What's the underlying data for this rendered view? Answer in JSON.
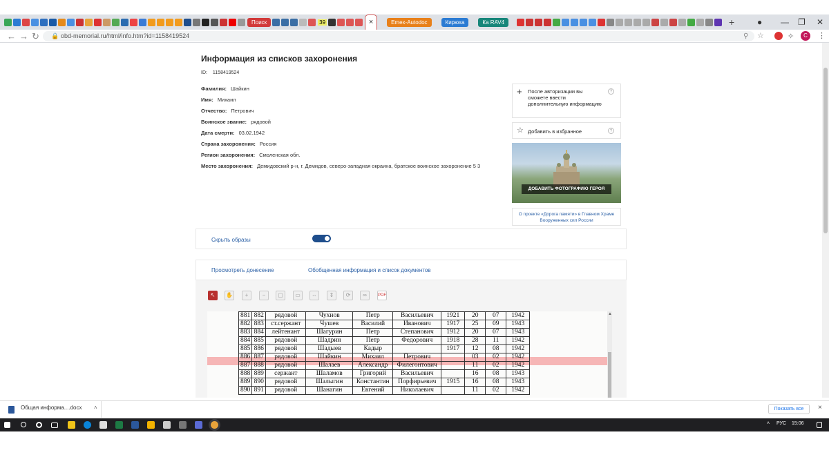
{
  "browser": {
    "tabs": {
      "search_pill": "Поиск",
      "num_badge": "39",
      "active_close": "×",
      "pill_orange": "Emex-Autodoc",
      "pill_blue": "Кирюха",
      "pill_teal": "Ка RAV4",
      "new_tab": "+"
    },
    "url": "obd-memorial.ru/html/info.htm?id=1158419524",
    "profile_initial": "C"
  },
  "page": {
    "title": "Информация из списков захоронения",
    "id_label": "ID:",
    "id_value": "1158419524",
    "fields": [
      {
        "label": "Фамилия:",
        "value": "Шайкин"
      },
      {
        "label": "Имя:",
        "value": "Михаил"
      },
      {
        "label": "Отчество:",
        "value": "Петрович"
      },
      {
        "label": "Воинское звание:",
        "value": "рядовой"
      },
      {
        "label": "Дата смерти:",
        "value": "03.02.1942"
      },
      {
        "label": "Страна захоронения:",
        "value": "Россия"
      },
      {
        "label": "Регион захоронения:",
        "value": "Смоленская обл."
      },
      {
        "label": "Место захоронения:",
        "value": "Демидовский р-н, г. Демидов, северо-западная окраина, братское воинское захоронение 5 3"
      }
    ],
    "sidebar": {
      "auth_text": "После авторизации вы сможете ввести дополнительную информацию",
      "favorite_text": "Добавить в избранное",
      "photo_button": "ДОБАВИТЬ ФОТОГРАФИЮ ГЕРОЯ",
      "about_link": "О проекте «Дорога памяти» в Главном Храме Вооруженных сил России"
    },
    "hide_images_label": "Скрыть образы",
    "hide_images_on": true,
    "tabs": {
      "report": "Просмотреть донесение",
      "summary": "Обобщенная информация и список документов"
    },
    "viewer_tools": [
      "select-icon",
      "hand-icon",
      "zoom-in-icon",
      "zoom-out-icon",
      "frame-icon",
      "fit-icon",
      "fit-width-icon",
      "fit-height-icon",
      "rotate-icon",
      "link-icon",
      "pdf-icon"
    ],
    "scan_rows": [
      {
        "n1": "881",
        "n2": "882",
        "rank": "рядовой",
        "surname": "Чухнов",
        "name": "Петр",
        "patronymic": "Васильевич",
        "year": "1921",
        "day": "20",
        "month": "07",
        "death_year": "1942"
      },
      {
        "n1": "882",
        "n2": "883",
        "rank": "ст.сержант",
        "surname": "Чушев",
        "name": "Василий",
        "patronymic": "Иванович",
        "year": "1917",
        "day": "25",
        "month": "09",
        "death_year": "1943"
      },
      {
        "n1": "883",
        "n2": "884",
        "rank": "лейтенант",
        "surname": "Шагурин",
        "name": "Петр",
        "patronymic": "Степанович",
        "year": "1912",
        "day": "20",
        "month": "07",
        "death_year": "1943"
      },
      {
        "n1": "884",
        "n2": "885",
        "rank": "рядовой",
        "surname": "Шадрин",
        "name": "Петр",
        "patronymic": "Федорович",
        "year": "1918",
        "day": "28",
        "month": "11",
        "death_year": "1942"
      },
      {
        "n1": "885",
        "n2": "886",
        "rank": "рядовой",
        "surname": "Шадыев",
        "name": "Кадыр",
        "patronymic": "",
        "year": "1917",
        "day": "12",
        "month": "08",
        "death_year": "1942"
      },
      {
        "n1": "886",
        "n2": "887",
        "rank": "рядовой",
        "surname": "Шайкин",
        "name": "Михаил",
        "patronymic": "Петрович",
        "year": "",
        "day": "03",
        "month": "02",
        "death_year": "1942"
      },
      {
        "n1": "887",
        "n2": "888",
        "rank": "рядовой",
        "surname": "Шалаев",
        "name": "Александр",
        "patronymic": "Филегонтович",
        "year": "",
        "day": "11",
        "month": "02",
        "death_year": "1942"
      },
      {
        "n1": "888",
        "n2": "889",
        "rank": "сержант",
        "surname": "Шаламов",
        "name": "Григорий",
        "patronymic": "Васильевич",
        "year": "",
        "day": "16",
        "month": "08",
        "death_year": "1943"
      },
      {
        "n1": "889",
        "n2": "890",
        "rank": "рядовой",
        "surname": "Шалыгин",
        "name": "Константин",
        "patronymic": "Порфирьевич",
        "year": "1915",
        "day": "16",
        "month": "08",
        "death_year": "1943"
      },
      {
        "n1": "890",
        "n2": "891",
        "rank": "рядовой",
        "surname": "Шанагин",
        "name": "Евгений",
        "patronymic": "Николаевич",
        "year": "",
        "day": "11",
        "month": "02",
        "death_year": "1942"
      }
    ],
    "highlight_row_index": 5
  },
  "download_bar": {
    "file": "Общая информа....docx",
    "show_all": "Показать все",
    "close": "×"
  },
  "taskbar": {
    "lang": "РУС",
    "time": "15:06"
  },
  "colors": {
    "accent_blue": "#1f4e8c",
    "link_blue": "#2a5fa5",
    "highlight": "#f6b6b6"
  }
}
